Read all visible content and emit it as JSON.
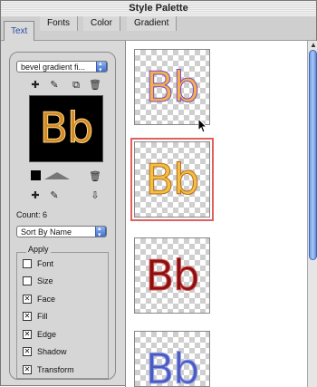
{
  "window": {
    "title": "Style Palette"
  },
  "tabs": [
    {
      "label": "Text",
      "active": true
    },
    {
      "label": "Fonts",
      "active": false
    },
    {
      "label": "Color",
      "active": false
    },
    {
      "label": "Gradient",
      "active": false
    }
  ],
  "left": {
    "style_dropdown": "bevel gradient fi...",
    "preview_text": "Bb",
    "count_label": "Count: 6",
    "sort_dropdown": "Sort By Name",
    "apply": {
      "title": "Apply",
      "items": [
        {
          "label": "Font",
          "checked": false
        },
        {
          "label": "Size",
          "checked": false
        },
        {
          "label": "Face",
          "checked": true
        },
        {
          "label": "Fill",
          "checked": true
        },
        {
          "label": "Edge",
          "checked": true
        },
        {
          "label": "Shadow",
          "checked": true
        },
        {
          "label": "Transform",
          "checked": true
        }
      ]
    }
  },
  "styles": [
    {
      "text": "Bb",
      "selected": false,
      "fill": "#f2b14a",
      "edge": "#7a4ac8"
    },
    {
      "text": "Bb",
      "selected": true,
      "fill": "#f0c040",
      "edge": "#b86a20"
    },
    {
      "text": "Bb",
      "selected": false,
      "fill": "#8a1010",
      "edge": "#d05050"
    },
    {
      "text": "Bb",
      "selected": false,
      "fill": "#4a5bc0",
      "edge": "#9aa4e8"
    }
  ],
  "colors": {
    "accent": "#3f6fd0",
    "selection_outline": "#e06060",
    "preview_bg": "#000000"
  }
}
